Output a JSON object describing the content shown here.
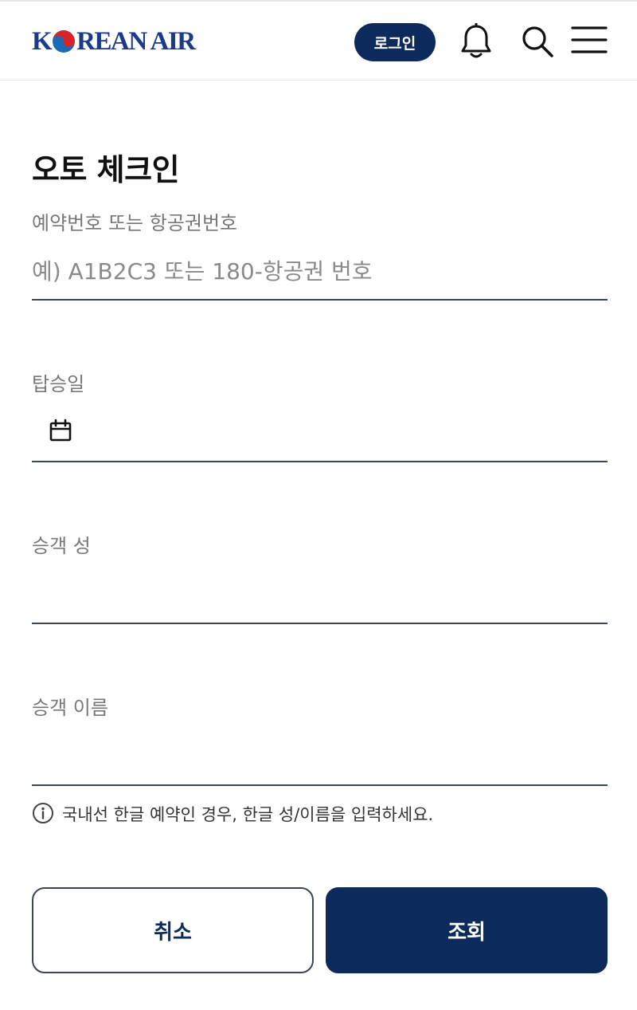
{
  "header": {
    "logo_left": "K",
    "logo_right": "REAN AIR",
    "login_label": "로그인"
  },
  "page": {
    "title": "오토 체크인"
  },
  "form": {
    "booking": {
      "label": "예약번호 또는 항공권번호",
      "placeholder": "예) A1B2C3 또는 180-항공권 번호",
      "value": ""
    },
    "date": {
      "label": "탑승일",
      "value": ""
    },
    "last_name": {
      "label": "승객 성",
      "value": ""
    },
    "first_name": {
      "label": "승객 이름",
      "value": ""
    },
    "note": "국내선 한글 예약인 경우, 한글 성/이름을 입력하세요."
  },
  "actions": {
    "cancel_label": "취소",
    "submit_label": "조회"
  },
  "colors": {
    "brand_navy": "#0c2a5c",
    "logo_blue": "#1b3a8a",
    "taeguk_red": "#d8232a",
    "taeguk_blue": "#1b6ab3"
  },
  "icons": [
    "taeguk-logo-icon",
    "bell-icon",
    "search-icon",
    "hamburger-menu-icon",
    "calendar-icon",
    "info-icon"
  ]
}
